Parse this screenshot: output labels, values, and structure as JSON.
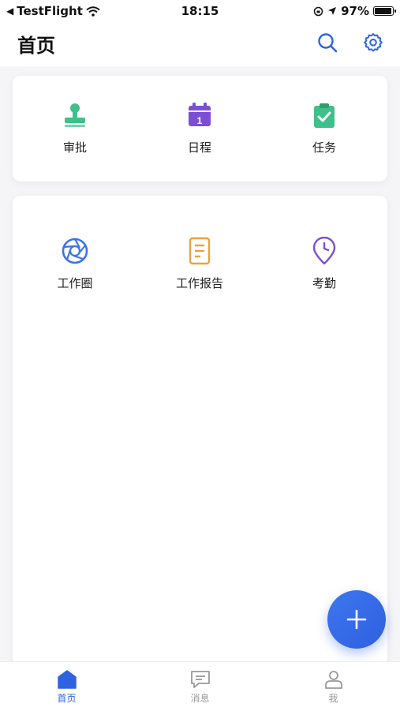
{
  "status_bar": {
    "back_app": "TestFlight",
    "time": "18:15",
    "battery": "97%",
    "battery_level": 0.97
  },
  "header": {
    "title": "首页",
    "search_icon": "search-icon",
    "settings_icon": "gear-icon"
  },
  "card1": {
    "items": [
      {
        "label": "审批",
        "icon": "stamp-icon",
        "color": "#3fbf8a"
      },
      {
        "label": "日程",
        "icon": "calendar-icon",
        "color": "#7a4fd6"
      },
      {
        "label": "任务",
        "icon": "clipboard-check-icon",
        "color": "#3fbf8a"
      }
    ]
  },
  "card2": {
    "items": [
      {
        "label": "工作圈",
        "icon": "aperture-icon",
        "color": "#3d73e3"
      },
      {
        "label": "工作报告",
        "icon": "report-icon",
        "color": "#e8a33c"
      },
      {
        "label": "考勤",
        "icon": "clock-pin-icon",
        "color": "#7a4fd6"
      }
    ]
  },
  "fab": {
    "icon": "plus-icon",
    "color": "#2f62e0"
  },
  "tabbar": {
    "items": [
      {
        "label": "首页",
        "icon": "home-icon",
        "active": true
      },
      {
        "label": "消息",
        "icon": "message-icon",
        "active": false
      },
      {
        "label": "我",
        "icon": "person-icon",
        "active": false
      }
    ],
    "active_color": "#2f62e0",
    "inactive_color": "#999999"
  }
}
